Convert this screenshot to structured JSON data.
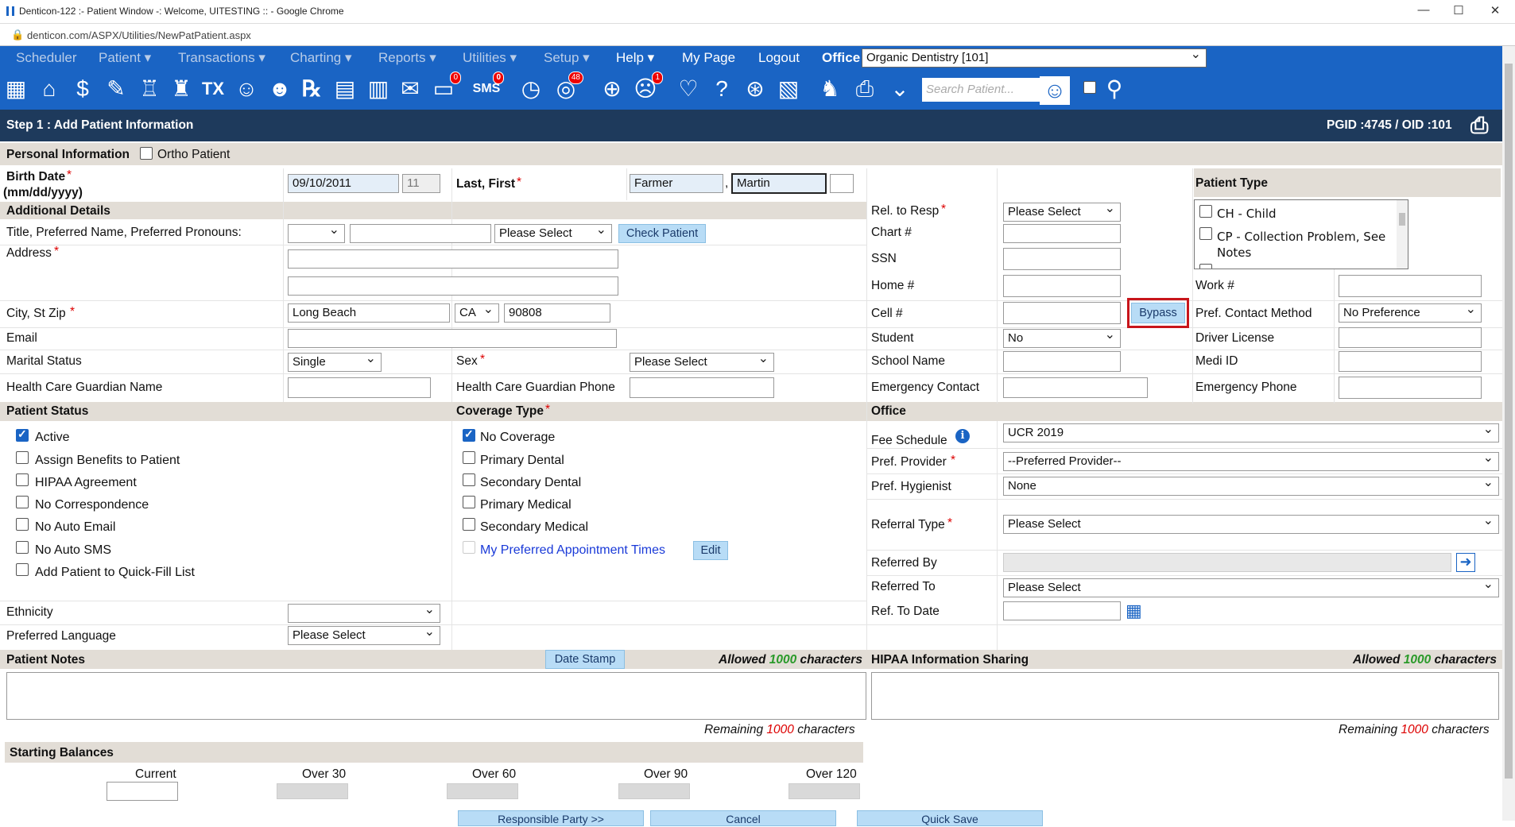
{
  "browser": {
    "title": "Denticon-122 :- Patient Window -: Welcome, UITESTING :: - Google Chrome",
    "url": "denticon.com/ASPX/Utilities/NewPatPatient.aspx"
  },
  "menu": {
    "items": [
      "Scheduler",
      "Patient ▾",
      "Transactions ▾",
      "Charting ▾",
      "Reports ▾",
      "Utilities ▾",
      "Setup ▾",
      "Help ▾",
      "My Page",
      "Logout"
    ],
    "office_label": "Office",
    "office_value": "Organic Dentistry [101]"
  },
  "toolbar": {
    "search_placeholder": "Search Patient...",
    "badge_msg": "0",
    "badge_sms": "0",
    "badge_globe": "48",
    "badge_alert": "1"
  },
  "step": {
    "title": "Step 1 : Add Patient Information",
    "ids": "PGID :4745  /  OID :101"
  },
  "personal": {
    "header": "Personal Information",
    "ortho": "Ortho Patient",
    "birth_label": "Birth Date",
    "birth_fmt": "(mm/dd/yyyy)",
    "birth_value": "09/10/2011",
    "age": "11",
    "name_label": "Last, First",
    "last": "Farmer",
    "first": "Martin"
  },
  "additional": {
    "header": "Additional Details",
    "title_label": "Title, Preferred Name, Preferred Pronouns:",
    "pronoun_select": "Please Select",
    "check_patient": "Check Patient",
    "address_label": "Address",
    "city_label": "City, St Zip",
    "city": "Long Beach",
    "state": "CA",
    "zip": "90808",
    "email_label": "Email",
    "marital_label": "Marital Status",
    "marital_value": "Single",
    "sex_label": "Sex",
    "sex_value": "Please Select",
    "hcg_name_label": "Health Care Guardian Name",
    "hcg_phone_label": "Health Care Guardian Phone"
  },
  "right": {
    "rel_label": "Rel. to Resp",
    "rel_value": "Please Select",
    "chart_label": "Chart #",
    "ssn_label": "SSN",
    "home_label": "Home #",
    "cell_label": "Cell #",
    "bypass": "Bypass",
    "student_label": "Student",
    "student_value": "No",
    "school_label": "School Name",
    "emergency_label": "Emergency Contact",
    "work_label": "Work #",
    "pref_contact_label": "Pref. Contact Method",
    "pref_contact_value": "No Preference",
    "driver_label": "Driver License",
    "medi_label": "Medi ID",
    "emergency_phone_label": "Emergency Phone",
    "ptype_header": "Patient Type",
    "ptype_items": [
      "CH - Child",
      "CP - Collection Problem, See Notes"
    ]
  },
  "status": {
    "header": "Patient Status",
    "items": [
      {
        "label": "Active",
        "checked": true
      },
      {
        "label": "Assign Benefits to Patient",
        "checked": false
      },
      {
        "label": "HIPAA Agreement",
        "checked": false
      },
      {
        "label": "No Correspondence",
        "checked": false
      },
      {
        "label": "No Auto Email",
        "checked": false
      },
      {
        "label": "No Auto SMS",
        "checked": false
      },
      {
        "label": "Add Patient to Quick-Fill List",
        "checked": false
      }
    ]
  },
  "coverage": {
    "header": "Coverage Type",
    "items": [
      {
        "label": "No Coverage",
        "checked": true
      },
      {
        "label": "Primary Dental",
        "checked": false
      },
      {
        "label": "Secondary Dental",
        "checked": false
      },
      {
        "label": "Primary Medical",
        "checked": false
      },
      {
        "label": "Secondary Medical",
        "checked": false
      }
    ],
    "appt_link": "My Preferred Appointment Times",
    "edit": "Edit"
  },
  "office": {
    "header": "Office",
    "fee_label": "Fee Schedule",
    "fee_value": "UCR 2019",
    "provider_label": "Pref. Provider",
    "provider_value": "--Preferred Provider--",
    "hygienist_label": "Pref. Hygienist",
    "hygienist_value": "None",
    "referral_label": "Referral Type",
    "referral_value": "Please Select",
    "referred_by_label": "Referred By",
    "referred_to_label": "Referred To",
    "referred_to_value": "Please Select",
    "ref_date_label": "Ref. To Date"
  },
  "misc": {
    "ethnicity_label": "Ethnicity",
    "language_label": "Preferred Language",
    "language_value": "Please Select"
  },
  "notes": {
    "header": "Patient Notes",
    "date_stamp": "Date Stamp",
    "allowed": "Allowed",
    "limit": "1000",
    "characters": "characters",
    "remaining": "Remaining",
    "hipaa_header": "HIPAA Information Sharing"
  },
  "balances": {
    "header": "Starting Balances",
    "cols": [
      "Current",
      "Over 30",
      "Over 60",
      "Over 90",
      "Over 120"
    ]
  },
  "footer": {
    "buttons": [
      "Responsible Party >>",
      "Cancel",
      "Quick Save"
    ]
  }
}
